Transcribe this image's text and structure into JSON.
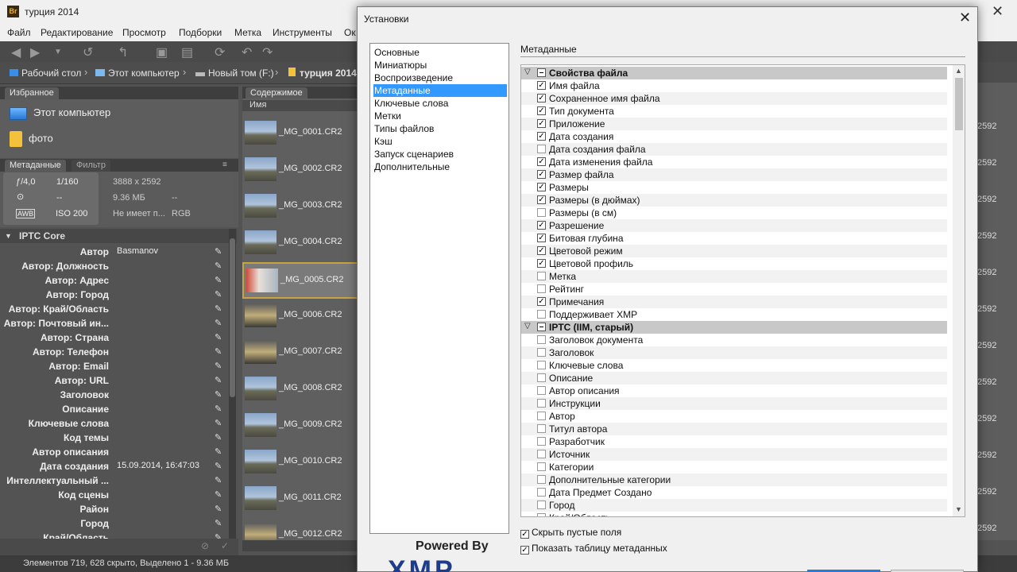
{
  "app": {
    "title": "турция 2014",
    "logo": "Br",
    "menu": [
      "Файл",
      "Редактирование",
      "Просмотр",
      "Подборки",
      "Метка",
      "Инструменты",
      "Ок"
    ]
  },
  "breadcrumb": [
    "Рабочий стол",
    "Этот компьютер",
    "Новый том (F:)",
    "турция 2014"
  ],
  "favorites": {
    "tab": "Избранное",
    "items": [
      "Этот компьютер",
      "фото"
    ]
  },
  "metadata_panel": {
    "tabs": [
      "Метаданные",
      "Фильтр"
    ],
    "aperture": "ƒ/4,0",
    "shutter": "1/160",
    "dims": "3888 x 2592",
    "size": "9.36 МБ",
    "dash1": "--",
    "dash2": "--",
    "dash3": "--",
    "profile": "Не имеет п...",
    "mode": "RGB",
    "iso": "ISO 200",
    "awb": "AWB"
  },
  "iptc": {
    "header": "IPTC Core",
    "rows": [
      {
        "label": "Автор",
        "value": "Basmanov"
      },
      {
        "label": "Автор: Должность",
        "value": ""
      },
      {
        "label": "Автор: Адрес",
        "value": ""
      },
      {
        "label": "Автор: Город",
        "value": ""
      },
      {
        "label": "Автор: Край/Область",
        "value": ""
      },
      {
        "label": "Автор: Почтовый ин...",
        "value": ""
      },
      {
        "label": "Автор: Страна",
        "value": ""
      },
      {
        "label": "Автор: Телефон",
        "value": ""
      },
      {
        "label": "Автор: Email",
        "value": ""
      },
      {
        "label": "Автор: URL",
        "value": ""
      },
      {
        "label": "Заголовок",
        "value": ""
      },
      {
        "label": "Описание",
        "value": ""
      },
      {
        "label": "Ключевые слова",
        "value": ""
      },
      {
        "label": "Код темы",
        "value": ""
      },
      {
        "label": "Автор описания",
        "value": ""
      },
      {
        "label": "Дата создания",
        "value": "15.09.2014, 16:47:03"
      },
      {
        "label": "Интеллектуальный ...",
        "value": ""
      },
      {
        "label": "Код сцены",
        "value": ""
      },
      {
        "label": "Район",
        "value": ""
      },
      {
        "label": "Город",
        "value": ""
      },
      {
        "label": "Край/Область",
        "value": ""
      }
    ]
  },
  "content": {
    "tab": "Содержимое",
    "column": "Имя",
    "files": [
      "_MG_0001.CR2",
      "_MG_0002.CR2",
      "_MG_0003.CR2",
      "_MG_0004.CR2",
      "_MG_0005.CR2",
      "_MG_0006.CR2",
      "_MG_0007.CR2",
      "_MG_0008.CR2",
      "_MG_0009.CR2",
      "_MG_0010.CR2",
      "_MG_0011.CR2",
      "_MG_0012.CR2"
    ],
    "right_value": "2592"
  },
  "status": "Элементов 719, 628 скрыто, Выделено 1 - 9.36 МБ",
  "dialog": {
    "title": "Установки",
    "nav": [
      "Основные",
      "Миниатюры",
      "Воспроизведение",
      "Метаданные",
      "Ключевые слова",
      "Метки",
      "Типы файлов",
      "Кэш",
      "Запуск сценариев",
      "Дополнительные"
    ],
    "selected_nav": 3,
    "section": "Метаданные",
    "rows": [
      {
        "text": "Свойства файла",
        "group": true
      },
      {
        "text": "Имя файла",
        "checked": true
      },
      {
        "text": "Сохраненное имя файла",
        "checked": true
      },
      {
        "text": "Тип документа",
        "checked": true
      },
      {
        "text": "Приложение",
        "checked": true
      },
      {
        "text": "Дата создания",
        "checked": true
      },
      {
        "text": "Дата создания файла",
        "checked": false
      },
      {
        "text": "Дата изменения файла",
        "checked": true
      },
      {
        "text": "Размер файла",
        "checked": true
      },
      {
        "text": "Размеры",
        "checked": true
      },
      {
        "text": "Размеры (в дюймах)",
        "checked": true
      },
      {
        "text": "Размеры (в см)",
        "checked": false
      },
      {
        "text": "Разрешение",
        "checked": true
      },
      {
        "text": "Битовая глубина",
        "checked": true
      },
      {
        "text": "Цветовой режим",
        "checked": true
      },
      {
        "text": "Цветовой профиль",
        "checked": true
      },
      {
        "text": "Метка",
        "checked": false
      },
      {
        "text": "Рейтинг",
        "checked": false
      },
      {
        "text": "Примечания",
        "checked": true
      },
      {
        "text": "Поддерживает XMP",
        "checked": false
      },
      {
        "text": "IPTC (IIM, старый)",
        "group": true
      },
      {
        "text": "Заголовок документа",
        "checked": false
      },
      {
        "text": "Заголовок",
        "checked": false
      },
      {
        "text": "Ключевые слова",
        "checked": false
      },
      {
        "text": "Описание",
        "checked": false
      },
      {
        "text": "Автор описания",
        "checked": false
      },
      {
        "text": "Инструкции",
        "checked": false
      },
      {
        "text": "Автор",
        "checked": false
      },
      {
        "text": "Титул автора",
        "checked": false
      },
      {
        "text": "Разработчик",
        "checked": false
      },
      {
        "text": "Источник",
        "checked": false
      },
      {
        "text": "Категории",
        "checked": false
      },
      {
        "text": "Дополнительные категории",
        "checked": false
      },
      {
        "text": "Дата Предмет Создано",
        "checked": false
      },
      {
        "text": "Город",
        "checked": false
      },
      {
        "text": "Край/Область",
        "checked": false
      }
    ],
    "options": [
      {
        "text": "Скрыть пустые поля",
        "checked": true
      },
      {
        "text": "Показать таблицу метаданных",
        "checked": true
      }
    ],
    "powered_by": "Powered By",
    "xmp": "XMP"
  }
}
